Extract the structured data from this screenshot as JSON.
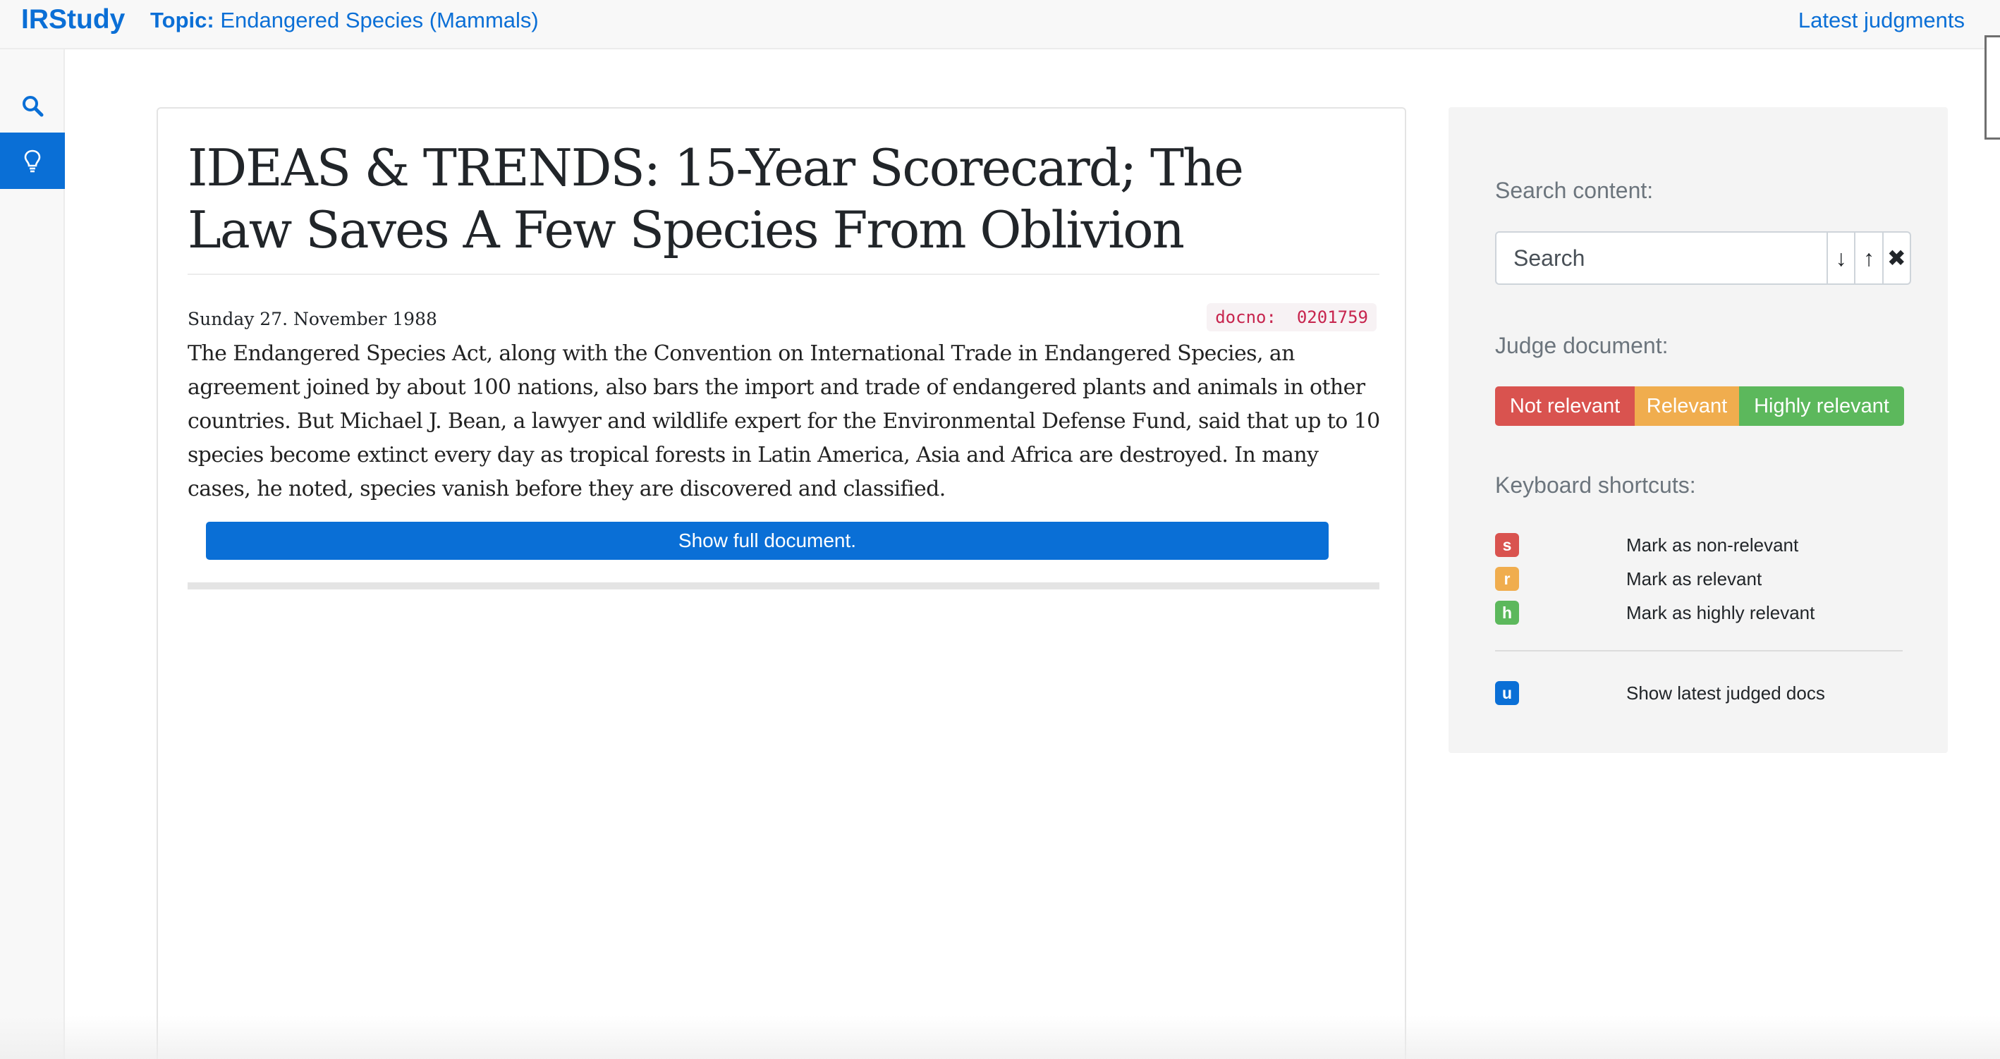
{
  "app": {
    "brand": "IRStudy",
    "topic_label": "Topic:",
    "topic_value": "Endangered Species (Mammals)",
    "latest_link": "Latest judgments"
  },
  "sidebar": {
    "items": [
      {
        "icon": "search-icon",
        "active": false
      },
      {
        "icon": "lightbulb-icon",
        "active": true
      }
    ]
  },
  "document": {
    "title": "IDEAS & TRENDS: 15-Year Scorecard; The Law Saves A Few Species From Oblivion",
    "date": "Sunday 27. November 1988",
    "docno_label": "docno:",
    "docno_value": "0201759",
    "text": "The Endangered Species Act, along with the Convention on International Trade in Endangered Species, an agreement joined by about 100 nations, also bars the import and trade of endangered plants and animals in other countries. But Michael J. Bean, a lawyer and wildlife expert for the Environmental Defense Fund, said that up to 10 species become extinct every day as tropical forests in Latin America, Asia and Africa are destroyed. In many cases, he noted, species vanish before they are discovered and classified.",
    "show_full_label": "Show full document."
  },
  "panel": {
    "search_label": "Search content:",
    "search_placeholder": "Search",
    "search_next": "↓",
    "search_prev": "↑",
    "search_clear": "✖",
    "judge_label": "Judge document:",
    "judge_buttons": {
      "not_relevant": "Not relevant",
      "relevant": "Relevant",
      "highly_relevant": "Highly relevant"
    },
    "shortcuts_label": "Keyboard shortcuts:",
    "shortcuts": [
      {
        "key": "s",
        "label": "Mark as non-relevant",
        "color": "#d9534f"
      },
      {
        "key": "r",
        "label": "Mark as relevant",
        "color": "#f0ad4e"
      },
      {
        "key": "h",
        "label": "Mark as highly relevant",
        "color": "#5cb85c"
      },
      {
        "key": "u",
        "label": "Show latest judged docs",
        "color": "#0a6fd6"
      }
    ]
  },
  "colors": {
    "accent": "#0a6fd6",
    "danger": "#d9534f",
    "warning": "#f0ad4e",
    "success": "#5cb85c"
  }
}
